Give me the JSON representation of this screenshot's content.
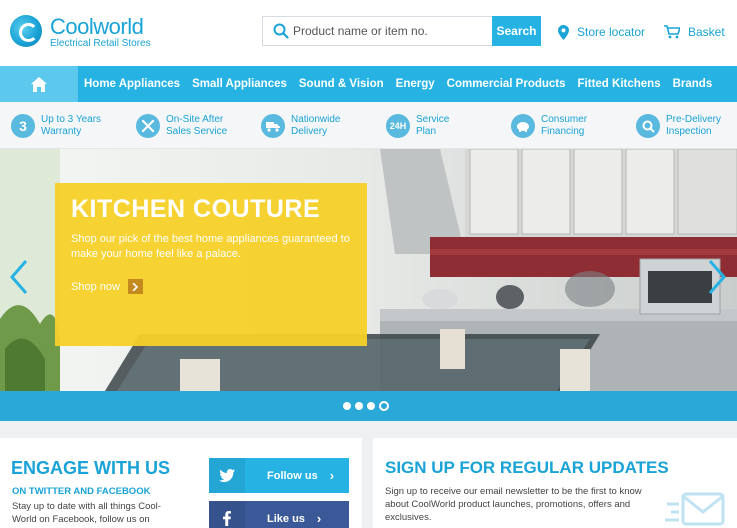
{
  "brand": {
    "name": "Coolworld",
    "tagline": "Electrical Retail Stores",
    "accent": "#26b3e4"
  },
  "search": {
    "placeholder": "Product name or item no.",
    "button": "Search"
  },
  "header_links": {
    "store_locator": "Store locator",
    "basket": "Basket"
  },
  "nav": {
    "items": [
      "Home Appliances",
      "Small Appliances",
      "Sound & Vision",
      "Energy",
      "Commercial Products",
      "Fitted Kitchens",
      "Brands"
    ]
  },
  "features": [
    {
      "icon": "3",
      "text": "Up to 3 Years\nWarranty"
    },
    {
      "icon": "tools-icon",
      "text": "On-Site After\nSales Service"
    },
    {
      "icon": "truck-icon",
      "text": "Nationwide\nDelivery"
    },
    {
      "icon": "24H",
      "text": "Service\nPlan"
    },
    {
      "icon": "piggy-bank-icon",
      "text": "Consumer\nFinancing"
    },
    {
      "icon": "search-icon",
      "text": "Pre-Delivery\nInspection"
    }
  ],
  "hero": {
    "title": "KITCHEN COUTURE",
    "text": "Shop our pick of the best home appliances guaranteed to make your home feel like a palace.",
    "cta": "Shop now",
    "slides": 4,
    "active_slide": 4
  },
  "engage": {
    "title": "ENGAGE WITH US",
    "subtitle": "ON TWITTER AND FACEBOOK",
    "text": "Stay up to date with all things Cool-World on Facebook, follow us on",
    "twitter_label": "Follow us",
    "facebook_label": "Like us"
  },
  "signup": {
    "title": "SIGN UP FOR REGULAR UPDATES",
    "text": "Sign up to receive our email newsletter to be the first to know about CoolWorld product launches, promotions, offers and exclusives."
  }
}
